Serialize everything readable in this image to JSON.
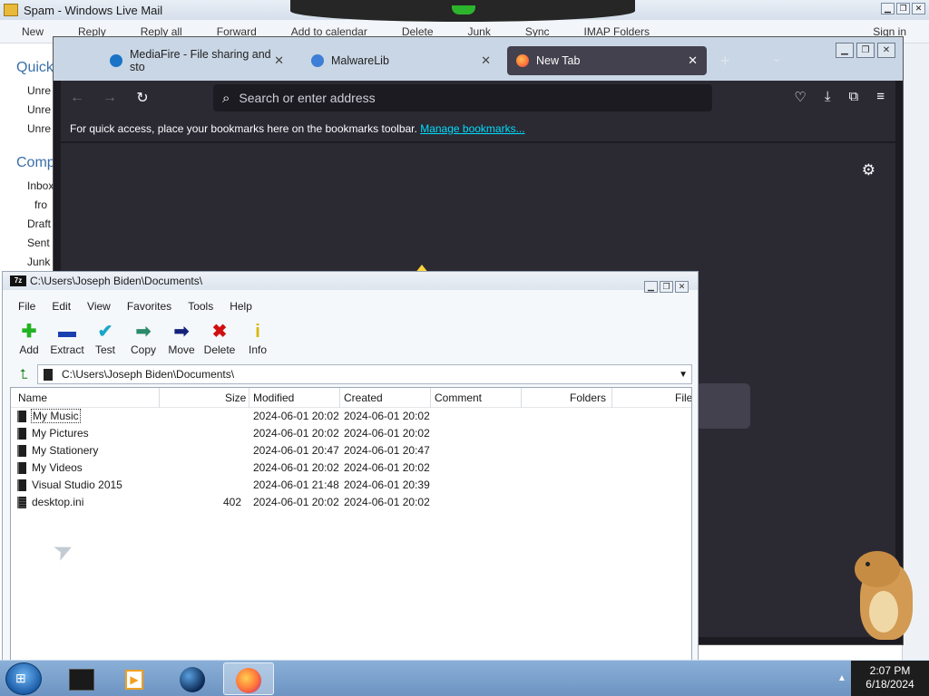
{
  "live_mail": {
    "title": "Spam - Windows Live Mail",
    "toolbar": [
      "New",
      "Reply",
      "Reply all",
      "Forward",
      "Add to calendar",
      "Delete",
      "Junk",
      "Sync",
      "IMAP Folders"
    ],
    "new_label": "New",
    "sign_in": "Sign in",
    "quick_views_header": "Quick",
    "quick_items": [
      "Unre",
      "Unre",
      "Unre"
    ],
    "account_header": "Comp",
    "folders": [
      "Inbox",
      "fro",
      "Draft",
      "Sent",
      "Junk"
    ]
  },
  "firefox": {
    "tabs": [
      {
        "label": "MediaFire - File sharing and sto",
        "icon": "mediafire-icon",
        "color": "#1a73c7"
      },
      {
        "label": "MalwareLib",
        "icon": "malwarelib-icon",
        "color": "#3d7ed6"
      },
      {
        "label": "New Tab",
        "icon": "firefox-icon",
        "color": "#ff7139"
      }
    ],
    "url_placeholder": "Search or enter address",
    "bookmarks_hint": "For quick access, place your bookmarks here on the bookmarks toolbar.",
    "manage_bookmarks": "Manage bookmarks..."
  },
  "sevenzip": {
    "title": "C:\\Users\\Joseph Biden\\Documents\\",
    "menu": [
      "File",
      "Edit",
      "View",
      "Favorites",
      "Tools",
      "Help"
    ],
    "tools": [
      {
        "label": "Add",
        "icon": "add-icon",
        "glyph": "✚",
        "color": "#22b322"
      },
      {
        "label": "Extract",
        "icon": "extract-icon",
        "glyph": "▬",
        "color": "#1a3fb0"
      },
      {
        "label": "Test",
        "icon": "test-icon",
        "glyph": "✔",
        "color": "#19a7c8"
      },
      {
        "label": "Copy",
        "icon": "copy-icon",
        "glyph": "➡",
        "color": "#2a8a6a"
      },
      {
        "label": "Move",
        "icon": "move-icon",
        "glyph": "➡",
        "color": "#13237a"
      },
      {
        "label": "Delete",
        "icon": "delete-icon",
        "glyph": "✖",
        "color": "#d01010"
      },
      {
        "label": "Info",
        "icon": "info-icon",
        "glyph": "i",
        "color": "#d6b800"
      }
    ],
    "address": "C:\\Users\\Joseph Biden\\Documents\\",
    "columns": [
      "Name",
      "Size",
      "Modified",
      "Created",
      "Comment",
      "Folders",
      "File"
    ],
    "rows": [
      {
        "name": "My Music",
        "size": "",
        "modified": "2024-06-01 20:02",
        "created": "2024-06-01 20:02",
        "type": "folder",
        "selected": true
      },
      {
        "name": "My Pictures",
        "size": "",
        "modified": "2024-06-01 20:02",
        "created": "2024-06-01 20:02",
        "type": "folder"
      },
      {
        "name": "My Stationery",
        "size": "",
        "modified": "2024-06-01 20:47",
        "created": "2024-06-01 20:47",
        "type": "folder"
      },
      {
        "name": "My Videos",
        "size": "",
        "modified": "2024-06-01 20:02",
        "created": "2024-06-01 20:02",
        "type": "folder"
      },
      {
        "name": "Visual Studio 2015",
        "size": "",
        "modified": "2024-06-01 21:48",
        "created": "2024-06-01 20:39",
        "type": "folder"
      },
      {
        "name": "desktop.ini",
        "size": "402",
        "modified": "2024-06-01 20:02",
        "created": "2024-06-01 20:02",
        "type": "file"
      }
    ]
  },
  "taskbar": {
    "time": "2:07 PM",
    "date": "6/18/2024",
    "apps": [
      "terminal-app-icon",
      "media-player-app-icon",
      "globe-app-icon",
      "firefox-app-icon"
    ]
  }
}
